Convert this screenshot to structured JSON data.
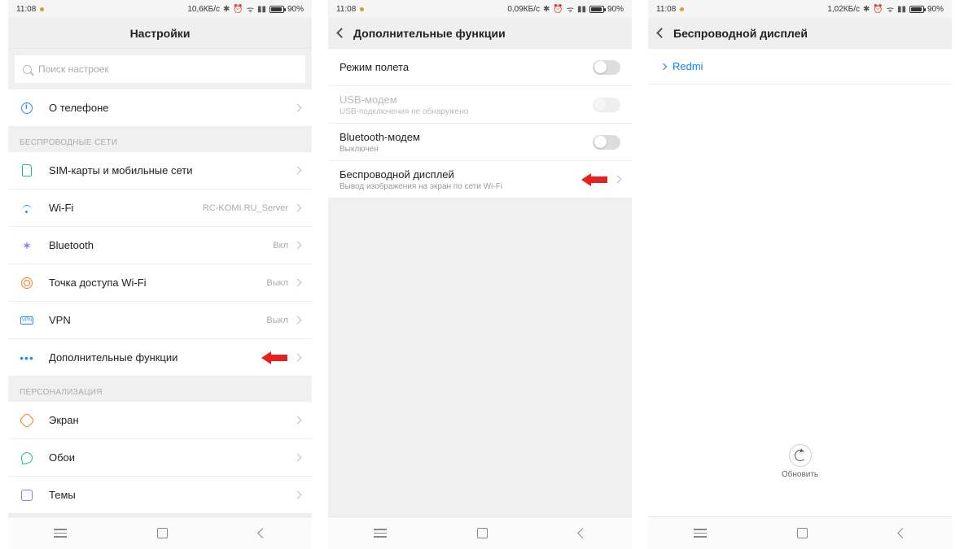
{
  "status": {
    "time": "11:08",
    "battery_pct": "90%",
    "net1": "10,6КБ/с",
    "net2": "0,09КБ/с",
    "net3": "1,02КБ/с"
  },
  "p1": {
    "title": "Настройки",
    "search_placeholder": "Поиск настроек",
    "about_label": "О телефоне",
    "sec_wireless": "БЕСПРОВОДНЫЕ СЕТИ",
    "sim_label": "SIM-карты и мобильные сети",
    "wifi_label": "Wi-Fi",
    "wifi_value": "RC-KOMI.RU_Server",
    "bt_label": "Bluetooth",
    "bt_value": "Вкл",
    "hotspot_label": "Точка доступа Wi-Fi",
    "hotspot_value": "Выкл",
    "vpn_label": "VPN",
    "vpn_value": "Выкл",
    "more_label": "Дополнительные функции",
    "sec_personal": "ПЕРСОНАЛИЗАЦИЯ",
    "display_label": "Экран",
    "wallpaper_label": "Обои",
    "themes_label": "Темы"
  },
  "p2": {
    "title": "Дополнительные функции",
    "airplane_label": "Режим полета",
    "usb_label": "USB-модем",
    "usb_sub": "USB-подключения не обнаружено",
    "btt_label": "Bluetooth-модем",
    "btt_sub": "Выключен",
    "wd_label": "Беспроводной дисплей",
    "wd_sub": "Вывод изображения на экран по сети Wi-Fi"
  },
  "p3": {
    "title": "Беспроводной дисплей",
    "device": "Redmi",
    "refresh": "Обновить"
  }
}
